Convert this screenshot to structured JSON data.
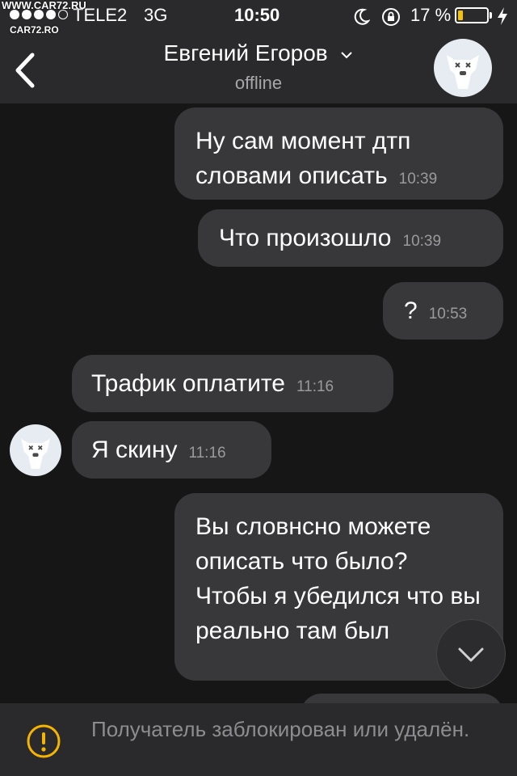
{
  "status_bar": {
    "carrier": "TELE2",
    "network": "3G",
    "time": "10:50",
    "battery_percent": "17 %",
    "battery_level": 0.17,
    "signal_bars_filled": 4,
    "watermark_top": "WWW.CAR72.RU",
    "watermark_logo": "CAR72.RO"
  },
  "header": {
    "contact_name": "Евгений Егоров",
    "status": "offline",
    "back_icon": "chevron-left-icon",
    "dropdown_icon": "chevron-down-icon"
  },
  "messages": [
    {
      "direction": "out",
      "text": "Ну сам момент дтп словами описать",
      "time": "10:39"
    },
    {
      "direction": "out",
      "text": "Что произошло",
      "time": "10:39"
    },
    {
      "direction": "out",
      "text": "?",
      "time": "10:53"
    },
    {
      "direction": "in",
      "text": "Трафик оплатите",
      "time": "11:16"
    },
    {
      "direction": "in",
      "text": "Я скину",
      "time": "11:16"
    },
    {
      "direction": "out",
      "text": "Вы словнсно можете описать что было? Чтобы я убедился что вы реально там был",
      "time": ""
    }
  ],
  "footer": {
    "notice": "Получатель заблокирован или удалён.",
    "icon": "warning-icon"
  },
  "colors": {
    "background": "#161617",
    "bar": "#2a2a2c",
    "bubble": "#38383b",
    "battery": "#f5c400"
  }
}
